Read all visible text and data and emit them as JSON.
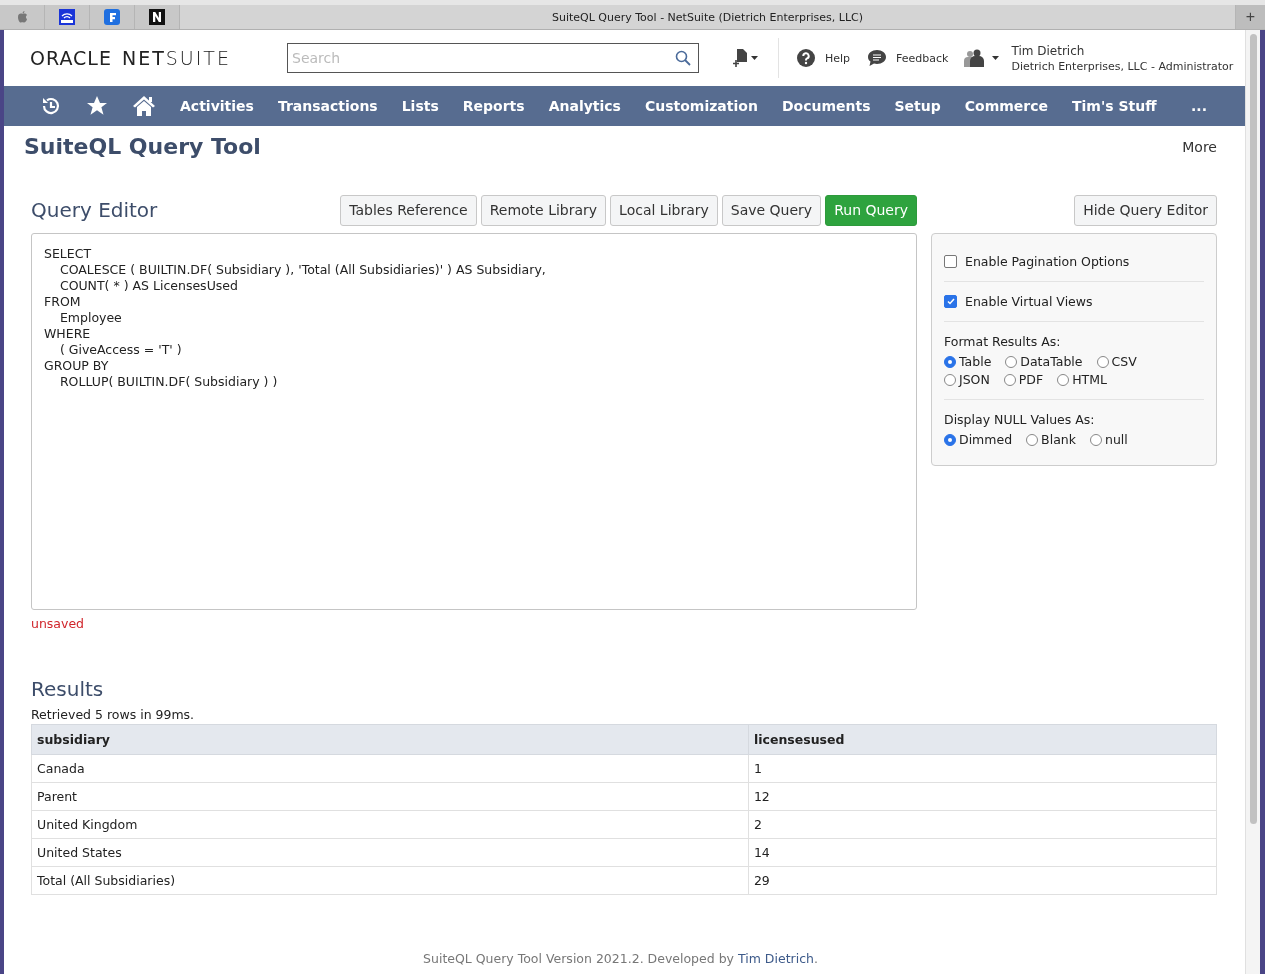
{
  "browser": {
    "title": "SuiteQL Query Tool - NetSuite (Dietrich Enterprises, LLC)",
    "pinned_tabs": [
      {
        "kind": "apple"
      },
      {
        "kind": "radio"
      },
      {
        "kind": "f"
      },
      {
        "kind": "n"
      }
    ],
    "new_tab": "+"
  },
  "header": {
    "logo": {
      "brand": "ORACLE",
      "product": "**NET**SUITE"
    },
    "search": {
      "placeholder": "Search"
    },
    "help": "Help",
    "feedback": "Feedback",
    "user": {
      "name": "Tim Dietrich",
      "role": "Dietrich Enterprises, LLC - Administrator"
    }
  },
  "nav": {
    "icons": [
      {
        "kind": "recent"
      },
      {
        "kind": "star"
      },
      {
        "kind": "home"
      }
    ],
    "items": [
      "Activities",
      "Transactions",
      "Lists",
      "Reports",
      "Analytics",
      "Customization",
      "Documents",
      "Setup",
      "Commerce",
      "Tim's Stuff"
    ],
    "more": "..."
  },
  "page": {
    "title": "SuiteQL Query Tool",
    "more": "More"
  },
  "editor": {
    "title": "Query Editor",
    "buttons": [
      {
        "label": "Tables Reference",
        "primary": false
      },
      {
        "label": "Remote Library",
        "primary": false
      },
      {
        "label": "Local Library",
        "primary": false
      },
      {
        "label": "Save Query",
        "primary": false
      },
      {
        "label": "Run Query",
        "primary": true
      }
    ],
    "hide_button": "Hide Query Editor",
    "code": "SELECT\n\tCOALESCE ( BUILTIN.DF( Subsidiary ), 'Total (All Subsidiaries)' ) AS Subsidiary,\n\tCOUNT( * ) AS LicensesUsed\nFROM\n\tEmployee\nWHERE\n\t( GiveAccess = 'T' )\nGROUP BY\n\tROLLUP( BUILTIN.DF( Subsidiary ) )",
    "status": "unsaved"
  },
  "options": {
    "checkboxes": [
      {
        "label": "Enable Pagination Options",
        "checked": false
      },
      {
        "label": "Enable Virtual Views",
        "checked": true
      }
    ],
    "format": {
      "label": "Format Results As:",
      "rows": [
        [
          {
            "label": "Table",
            "selected": true
          },
          {
            "label": "DataTable",
            "selected": false
          },
          {
            "label": "CSV",
            "selected": false
          }
        ],
        [
          {
            "label": "JSON",
            "selected": false
          },
          {
            "label": "PDF",
            "selected": false
          },
          {
            "label": "HTML",
            "selected": false
          }
        ]
      ]
    },
    "nulls": {
      "label": "Display NULL Values As:",
      "choices": [
        {
          "label": "Dimmed",
          "selected": true
        },
        {
          "label": "Blank",
          "selected": false
        },
        {
          "label": "null",
          "selected": false
        }
      ]
    }
  },
  "results": {
    "title": "Results",
    "summary": "Retrieved 5 rows in 99ms.",
    "columns": [
      "subsidiary",
      "licensesused"
    ],
    "rows": [
      [
        "Canada",
        "1"
      ],
      [
        "Parent",
        "12"
      ],
      [
        "United Kingdom",
        "2"
      ],
      [
        "United States",
        "14"
      ],
      [
        "Total (All Subsidiaries)",
        "29"
      ]
    ]
  },
  "footer": {
    "text": "SuiteQL Query Tool Version 2021.2. Developed by",
    "link": "Tim Dietrich",
    "suffix": "."
  }
}
